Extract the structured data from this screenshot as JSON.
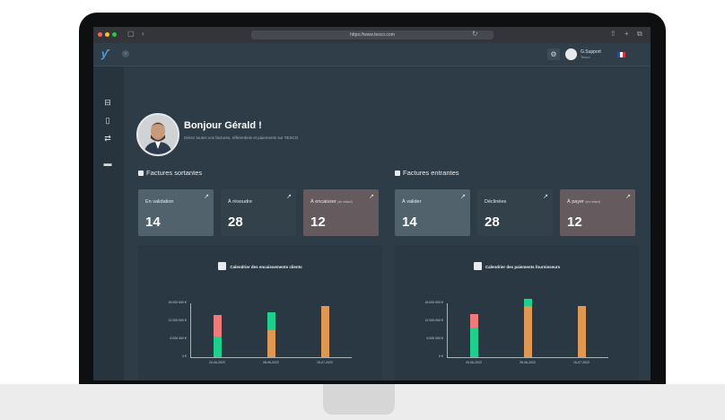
{
  "browser": {
    "url": "https://www.tesco.com"
  },
  "topbar": {
    "logo": "ƴ",
    "user_name": "G.Support",
    "user_role": "Tesco"
  },
  "greeting": {
    "title": "Bonjour Gérald !",
    "subtitle": "Gérez toutes vos factures, référentiels et paiements sur TESCO"
  },
  "sections": {
    "outgoing": "Factures sortantes",
    "incoming": "Factures entrantes"
  },
  "cards": {
    "outgoing": [
      {
        "label": "En validation",
        "note": "",
        "value": "14",
        "bg": "#52626d"
      },
      {
        "label": "À résoudre",
        "note": "",
        "value": "28",
        "bg": "#33414b"
      },
      {
        "label": "À encaisser",
        "note": "(en retard)",
        "value": "12",
        "bg": "#655a5d"
      }
    ],
    "incoming": [
      {
        "label": "À valider",
        "note": "",
        "value": "14",
        "bg": "#52626d"
      },
      {
        "label": "Déclinées",
        "note": "",
        "value": "28",
        "bg": "#33414b"
      },
      {
        "label": "À payer",
        "note": "(en retard)",
        "value": "12",
        "bg": "#655a5d"
      }
    ]
  },
  "colors": {
    "green": "#1fcf8e",
    "red": "#ef7a7a",
    "orange": "#e09752"
  },
  "chart_data": [
    {
      "type": "bar",
      "title": "Calendrier des encaissements clients",
      "categories": [
        "20-06-2022",
        "28-06-2022",
        "15-07-2022"
      ],
      "yticks": [
        "18 000 000 €",
        "12 000 000 €",
        "6 000 000 €",
        "0 €"
      ],
      "ylim": [
        0,
        18000000
      ],
      "series": [
        {
          "color": "#1fcf8e",
          "values": [
            7000000,
            0,
            0
          ]
        },
        {
          "color": "#e09752",
          "values": [
            0,
            9000000,
            17000000
          ]
        },
        {
          "color": "#ef7a7a",
          "values": [
            7000000,
            0,
            0
          ]
        },
        {
          "color": "#1fcf8e",
          "values": [
            0,
            6000000,
            0
          ]
        }
      ]
    },
    {
      "type": "bar",
      "title": "Calendrier des paiements fournisseurs",
      "categories": [
        "20-06-2022",
        "28-06-2022",
        "15-07-2022"
      ],
      "yticks": [
        "18 000 000 €",
        "12 000 000 €",
        "6 000 000 €",
        "0 €"
      ],
      "ylim": [
        0,
        18000000
      ],
      "series": [
        {
          "color": "#1fcf8e",
          "values": [
            10000000,
            0,
            0
          ]
        },
        {
          "color": "#e09752",
          "values": [
            0,
            17000000,
            17000000
          ]
        },
        {
          "color": "#ef7a7a",
          "values": [
            4500000,
            0,
            0
          ]
        },
        {
          "color": "#1fcf8e",
          "values": [
            0,
            2500000,
            0
          ]
        }
      ]
    }
  ]
}
